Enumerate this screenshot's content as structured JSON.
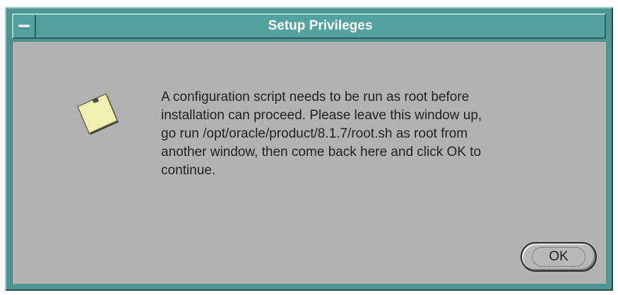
{
  "window": {
    "title": "Setup Privileges"
  },
  "dialog": {
    "message": "A configuration script needs to be run as root before\ninstallation can proceed. Please leave this window up,\ngo run /opt/oracle/product/8.1.7/root.sh as root from\nanother window, then come back here and click OK to\ncontinue.",
    "icon": "note-icon"
  },
  "buttons": {
    "ok_label": "OK"
  },
  "colors": {
    "frame": "#4e9593",
    "titlebar": "#54a29f",
    "client": "#b2b2b2",
    "note": "#f3eeb2"
  }
}
